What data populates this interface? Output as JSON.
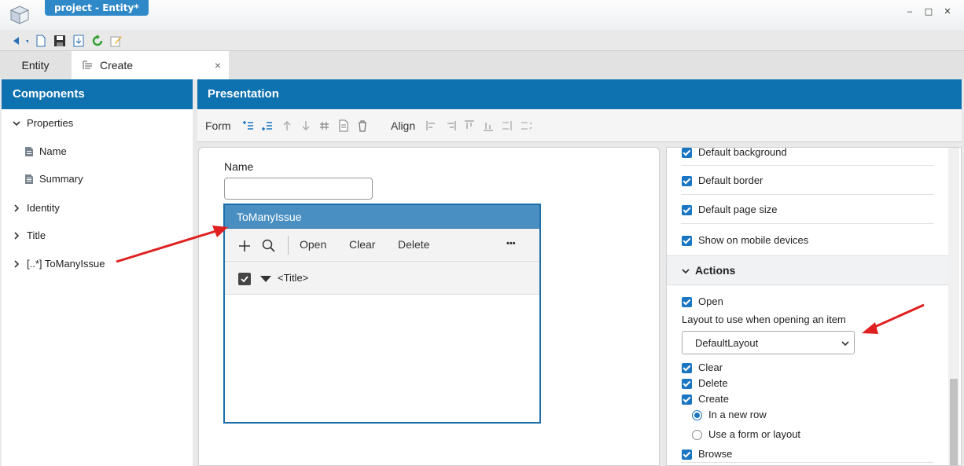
{
  "window": {
    "title": "project - Entity*",
    "minimize": "‒",
    "maximize": "□",
    "close": "✕"
  },
  "toolbar": {
    "icons": [
      "back-icon",
      "new-icon",
      "save-icon",
      "export-icon",
      "refresh-icon",
      "edit-icon"
    ]
  },
  "tabs": [
    {
      "label": "Entity"
    },
    {
      "label": "Create",
      "close": "×"
    }
  ],
  "components": {
    "title": "Components",
    "items": [
      {
        "label": "Properties",
        "expanded": true
      },
      {
        "label": "Name",
        "child": true
      },
      {
        "label": "Summary",
        "child": true
      },
      {
        "label": "Identity"
      },
      {
        "label": "Title"
      },
      {
        "label": "[..*] ToManyIssue"
      }
    ]
  },
  "presentation": {
    "title": "Presentation",
    "form_label": "Form",
    "align_label": "Align"
  },
  "form": {
    "name_label": "Name",
    "name_value": "",
    "tomany": {
      "title": "ToManyIssue",
      "buttons": {
        "open": "Open",
        "clear": "Clear",
        "delete": "Delete",
        "more": "•••"
      },
      "row_title": "<Title>"
    }
  },
  "props": {
    "default_background": "Default background",
    "default_border": "Default border",
    "default_page_size": "Default page size",
    "show_mobile": "Show on mobile devices",
    "actions_title": "Actions",
    "open": "Open",
    "layout_label": "Layout to use when opening an item",
    "layout_value": "DefaultLayout",
    "clear": "Clear",
    "delete": "Delete",
    "create": "Create",
    "in_new_row": "In a new row",
    "use_form": "Use a form or layout",
    "browse": "Browse"
  },
  "colors": {
    "accent": "#0e71b0",
    "checkbox": "#1a76c2",
    "arrow": "#e02020"
  }
}
